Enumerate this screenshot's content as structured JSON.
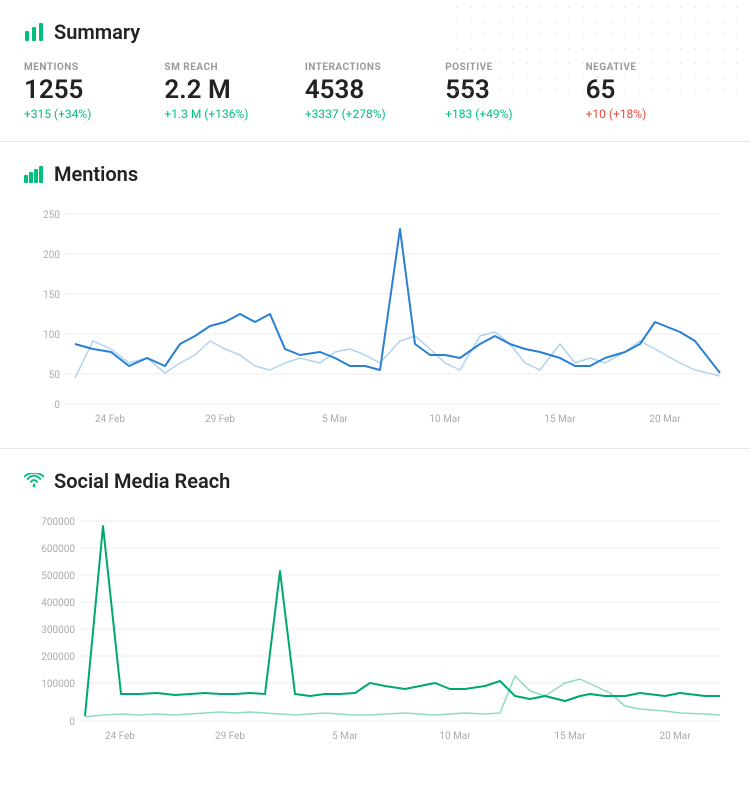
{
  "summary": {
    "title": "Summary",
    "metrics": [
      {
        "label": "MENTIONS",
        "value": "1255",
        "change": "+315 (+34%)",
        "change_type": "positive"
      },
      {
        "label": "SM REACH",
        "value": "2.2 M",
        "change": "+1.3 M (+136%)",
        "change_type": "positive"
      },
      {
        "label": "INTERACTIONS",
        "value": "4538",
        "change": "+3337 (+278%)",
        "change_type": "positive"
      },
      {
        "label": "POSITIVE",
        "value": "553",
        "change": "+183 (+49%)",
        "change_type": "positive"
      },
      {
        "label": "NEGATIVE",
        "value": "65",
        "change": "+10 (+18%)",
        "change_type": "negative"
      }
    ]
  },
  "mentions_chart": {
    "title": "Mentions",
    "y_labels": [
      "250",
      "200",
      "150",
      "100",
      "50",
      "0"
    ],
    "x_labels": [
      "24 Feb",
      "29 Feb",
      "5 Mar",
      "10 Mar",
      "15 Mar",
      "20 Mar"
    ]
  },
  "reach_chart": {
    "title": "Social Media Reach",
    "y_labels": [
      "700000",
      "600000",
      "500000",
      "400000",
      "300000",
      "200000",
      "100000",
      "0"
    ],
    "x_labels": [
      "24 Feb",
      "29 Feb",
      "5 Mar",
      "10 Mar",
      "15 Mar",
      "20 Mar"
    ]
  }
}
